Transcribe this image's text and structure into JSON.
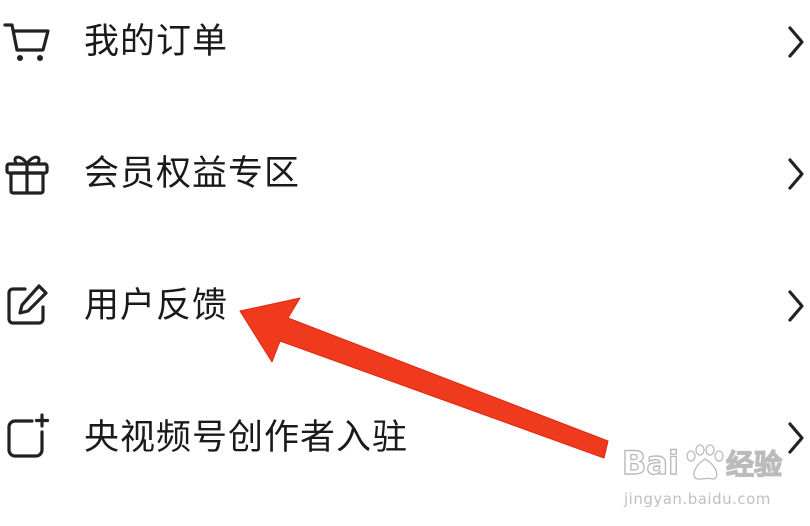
{
  "menu": {
    "items": [
      {
        "label": "我的订单",
        "icon": "cart-icon"
      },
      {
        "label": "会员权益专区",
        "icon": "gift-icon"
      },
      {
        "label": "用户反馈",
        "icon": "edit-icon"
      },
      {
        "label": "央视频号创作者入驻",
        "icon": "square-plus-icon"
      }
    ]
  },
  "colors": {
    "text": "#1a1a1a",
    "icon": "#222222",
    "chevron": "#222222",
    "annotation_arrow": "#f03a1e"
  },
  "watermark": {
    "brand": "Baidu经验",
    "url": "jingyan.baidu.com"
  }
}
